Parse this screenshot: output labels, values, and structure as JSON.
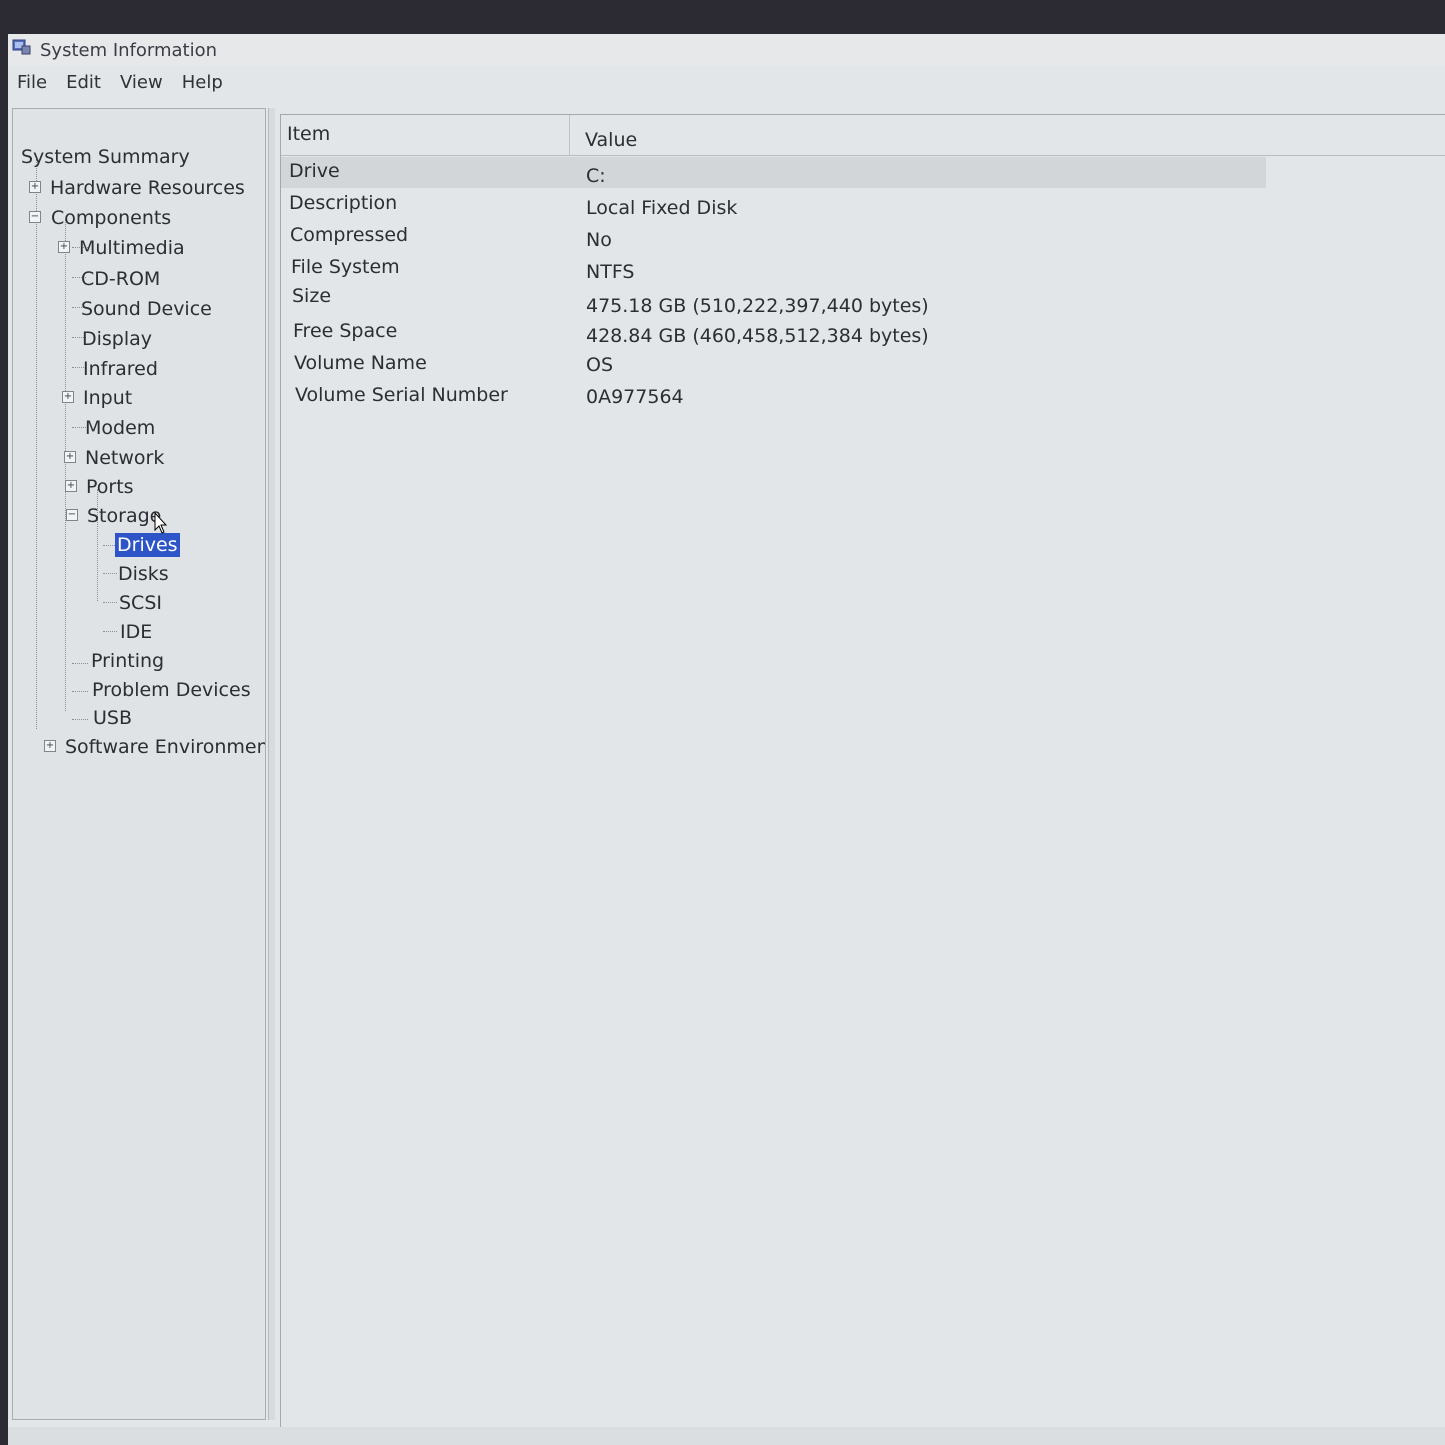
{
  "window": {
    "title": "System Information",
    "app_icon": "system-information-icon"
  },
  "menubar": {
    "items": [
      "File",
      "Edit",
      "View",
      "Help"
    ]
  },
  "tree": {
    "items": [
      {
        "label": "System Summary",
        "level": 0
      },
      {
        "label": "Hardware Resources",
        "level": 1,
        "toggle": "+"
      },
      {
        "label": "Components",
        "level": 1,
        "toggle": "-"
      },
      {
        "label": "Multimedia",
        "level": 2,
        "toggle": "+"
      },
      {
        "label": "CD-ROM",
        "level": 2
      },
      {
        "label": "Sound Device",
        "level": 2
      },
      {
        "label": "Display",
        "level": 2
      },
      {
        "label": "Infrared",
        "level": 2
      },
      {
        "label": "Input",
        "level": 2,
        "toggle": "+"
      },
      {
        "label": "Modem",
        "level": 2
      },
      {
        "label": "Network",
        "level": 2,
        "toggle": "+"
      },
      {
        "label": "Ports",
        "level": 2,
        "toggle": "+"
      },
      {
        "label": "Storage",
        "level": 2,
        "toggle": "-"
      },
      {
        "label": "Drives",
        "level": 3,
        "selected": true
      },
      {
        "label": "Disks",
        "level": 3
      },
      {
        "label": "SCSI",
        "level": 3
      },
      {
        "label": "IDE",
        "level": 3
      },
      {
        "label": "Printing",
        "level": 2
      },
      {
        "label": "Problem Devices",
        "level": 2
      },
      {
        "label": "USB",
        "level": 2
      },
      {
        "label": "Software Environment",
        "level": 1,
        "toggle": "+"
      }
    ]
  },
  "details": {
    "columns": {
      "item": "Item",
      "value": "Value"
    },
    "rows": [
      {
        "item": "Drive",
        "value": "C:"
      },
      {
        "item": "Description",
        "value": "Local Fixed Disk"
      },
      {
        "item": "Compressed",
        "value": "No"
      },
      {
        "item": "File System",
        "value": "NTFS"
      },
      {
        "item": "Size",
        "value": "475.18 GB (510,222,397,440 bytes)"
      },
      {
        "item": "Free Space",
        "value": "428.84 GB (460,458,512,384 bytes)"
      },
      {
        "item": "Volume Name",
        "value": "OS"
      },
      {
        "item": "Volume Serial Number",
        "value": "0A977564"
      }
    ]
  },
  "colors": {
    "selection": "#2d55c8",
    "pane_background": "#e2e6e8"
  }
}
